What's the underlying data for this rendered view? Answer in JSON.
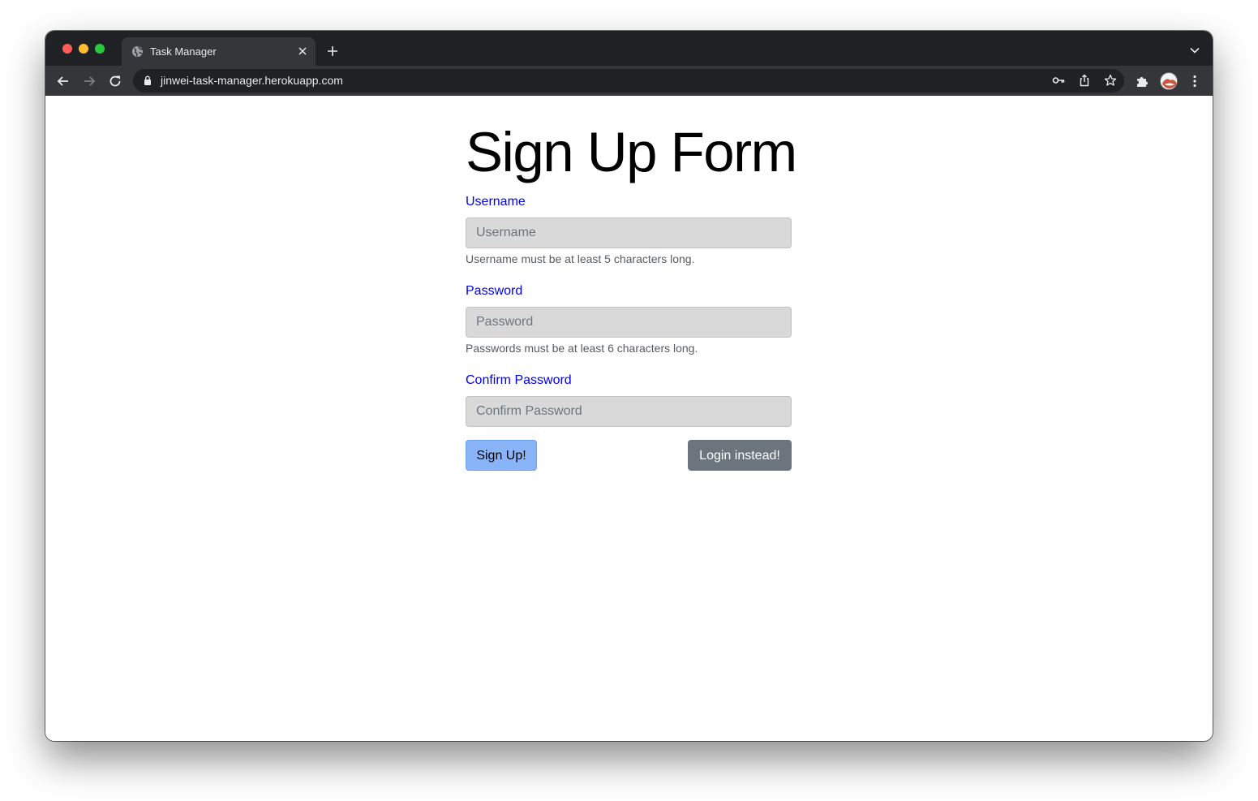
{
  "browser": {
    "tab": {
      "title": "Task Manager",
      "favicon": "globe-icon"
    },
    "url": "jinwei-task-manager.herokuapp.com",
    "icons": [
      "back-arrow-icon",
      "forward-arrow-icon",
      "reload-icon",
      "lock-icon",
      "key-icon",
      "share-icon",
      "star-icon",
      "puzzle-icon",
      "avatar",
      "kebab-menu-icon"
    ]
  },
  "page": {
    "title": "Sign Up Form",
    "fields": [
      {
        "label": "Username",
        "placeholder": "Username",
        "help": "Username must be at least 5 characters long."
      },
      {
        "label": "Password",
        "placeholder": "Password",
        "help": "Passwords must be at least 6 characters long."
      },
      {
        "label": "Confirm Password",
        "placeholder": "Confirm Password"
      }
    ],
    "buttons": {
      "signup": "Sign Up!",
      "login": "Login instead!"
    }
  },
  "colors": {
    "label": "#0000ee",
    "input_bg": "#d9d9d9",
    "primary_button": "#8ab4f8",
    "secondary_button": "#6c757d",
    "tab_strip": "#202124",
    "toolbar": "#35363a"
  }
}
